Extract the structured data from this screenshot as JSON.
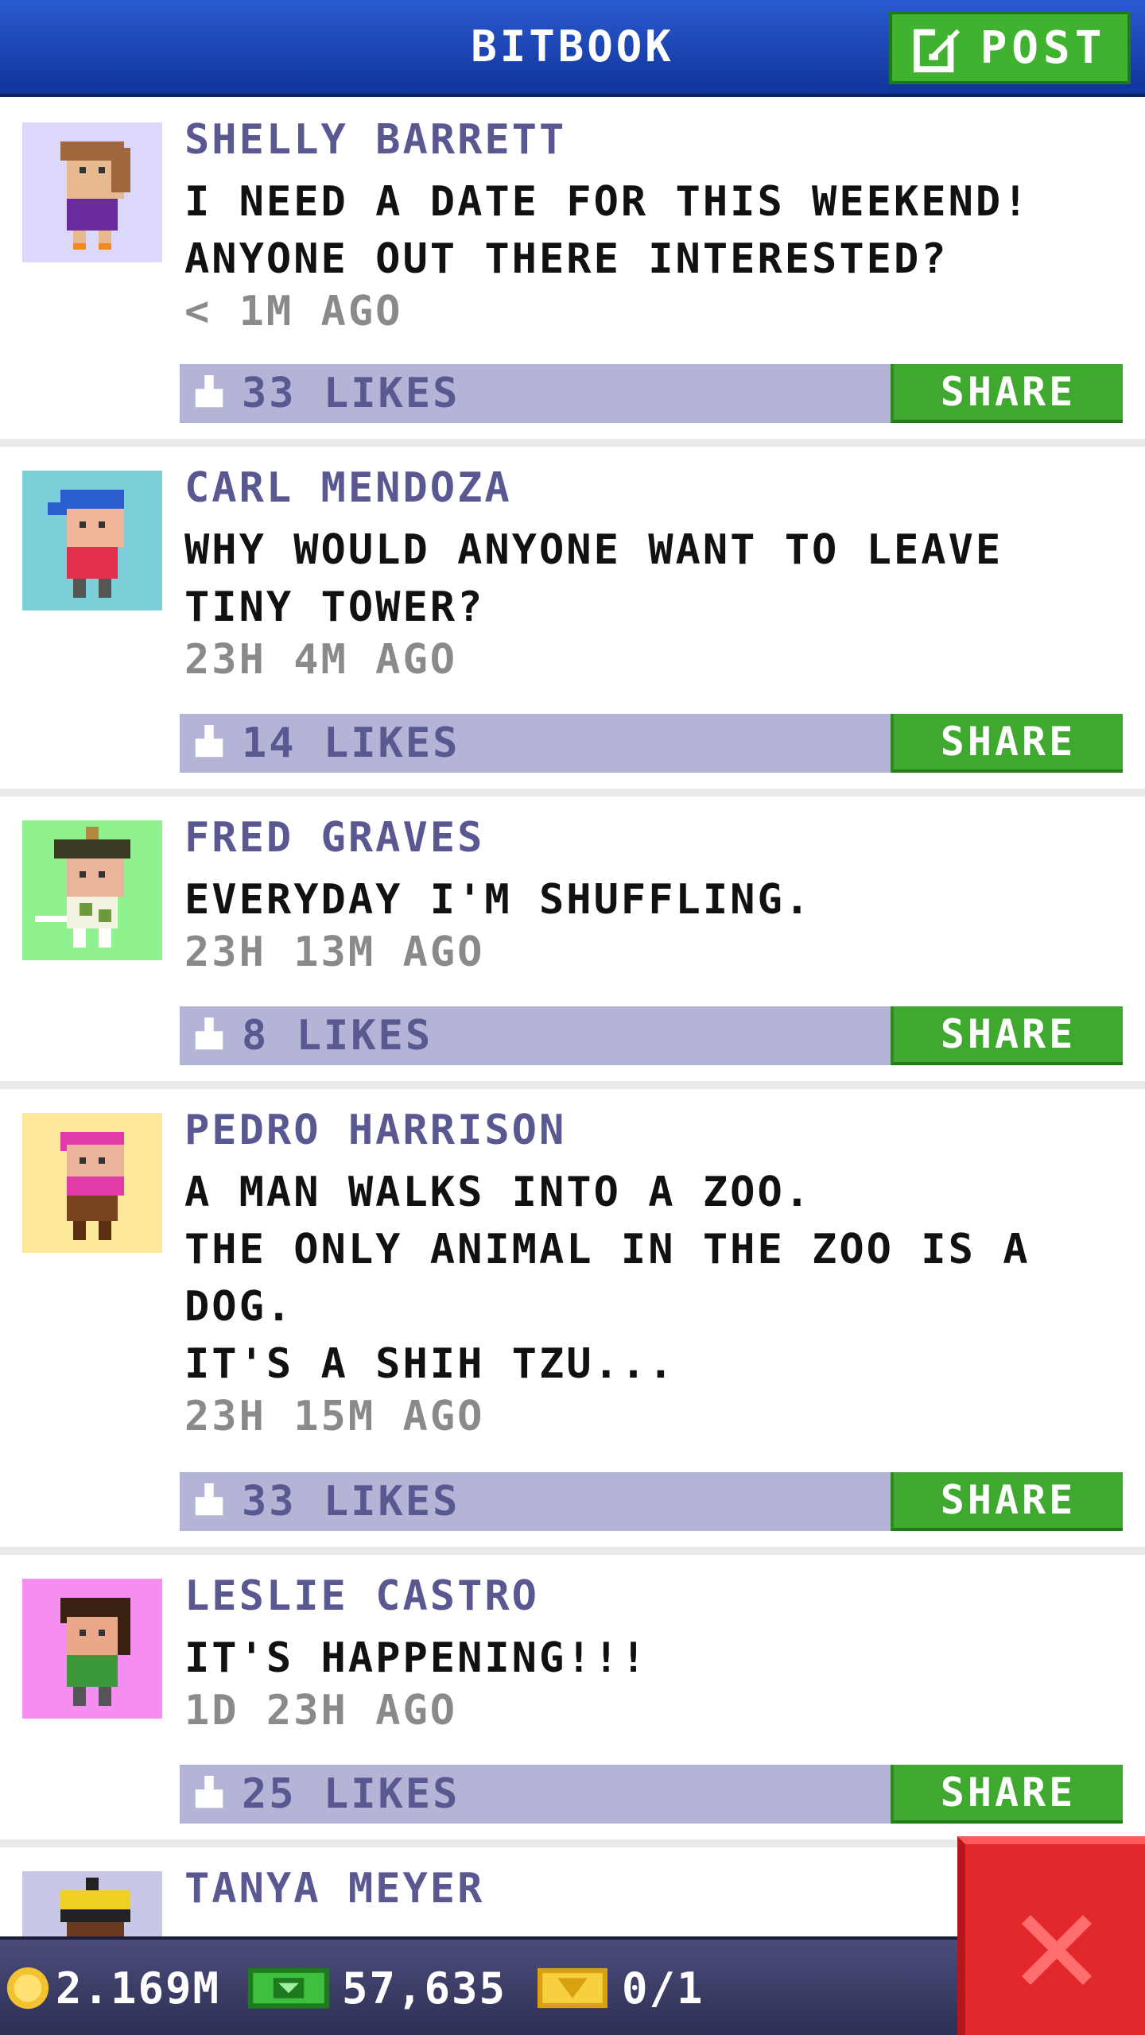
{
  "header": {
    "title": "BITBOOK",
    "post_label": "POST"
  },
  "posts": [
    {
      "name": "SHELLY BARRETT",
      "lines": [
        "I NEED A DATE FOR THIS WEEKEND!",
        "ANYONE OUT THERE INTERESTED?"
      ],
      "time": "< 1M AGO",
      "likes": "33 LIKES",
      "share": "SHARE",
      "avatar_bg": "#dcd8fb"
    },
    {
      "name": "CARL MENDOZA",
      "lines": [
        "WHY WOULD ANYONE WANT TO LEAVE",
        "TINY TOWER?"
      ],
      "time": "23H 4M AGO",
      "likes": "14 LIKES",
      "share": "SHARE",
      "avatar_bg": "#7ccfd9"
    },
    {
      "name": "FRED GRAVES",
      "lines": [
        "EVERYDAY I'M SHUFFLING."
      ],
      "time": "23H 13M AGO",
      "likes": "8 LIKES",
      "share": "SHARE",
      "avatar_bg": "#8ff28f"
    },
    {
      "name": "PEDRO HARRISON",
      "lines": [
        "A MAN WALKS INTO A ZOO.",
        "THE ONLY ANIMAL IN THE ZOO IS A",
        "DOG.",
        "IT'S A SHIH TZU..."
      ],
      "time": "23H 15M AGO",
      "likes": "33 LIKES",
      "share": "SHARE",
      "avatar_bg": "#fde89a"
    },
    {
      "name": "LESLIE CASTRO",
      "lines": [
        "IT'S HAPPENING!!!"
      ],
      "time": "1D 23H AGO",
      "likes": "25 LIKES",
      "share": "SHARE",
      "avatar_bg": "#f58ef0"
    },
    {
      "name": "TANYA MEYER",
      "lines": [],
      "time": "",
      "likes": "",
      "share": "",
      "avatar_bg": "#c9c7e8"
    }
  ],
  "bottom_bar": {
    "coins": "2.169M",
    "bux": "57,635",
    "vip": "0/1"
  },
  "icons": {
    "post": "edit-icon",
    "like": "thumbs-up-icon",
    "coin": "coin-icon",
    "bux": "bux-icon",
    "vip": "vip-ticket-icon",
    "close": "close-icon"
  },
  "colors": {
    "header": "#1a46b8",
    "accent_green": "#3fa82e",
    "name": "#5a5891",
    "like_bar": "#b3b4d6",
    "close": "#e3282c"
  }
}
